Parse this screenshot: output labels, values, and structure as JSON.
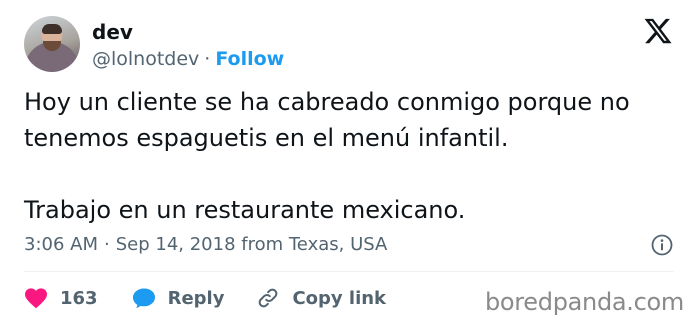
{
  "author": {
    "display_name": "dev",
    "handle": "@lolnotdev",
    "separator": "·",
    "follow_label": "Follow"
  },
  "tweet": {
    "lines_paragraph_1": [
      "Hoy un cliente se ha cabreado conmigo porque no",
      "tenemos espaguetis en el menú infantil."
    ],
    "paragraph_2": "Trabajo en un restaurante mexicano."
  },
  "meta": {
    "time": "3:06 AM",
    "separator": "·",
    "date_location": "Sep 14, 2018 from Texas, USA"
  },
  "actions": {
    "like_count": "163",
    "reply_label": "Reply",
    "copy_link_label": "Copy link"
  },
  "watermark": "boredpanda.com",
  "icons": {
    "logo": "x-logo-icon",
    "info": "info-icon",
    "like": "heart-icon",
    "reply": "speech-bubble-icon",
    "copy_link": "link-icon"
  },
  "colors": {
    "like": "#f91880",
    "reply": "#1d9bf0",
    "follow": "#1d9bf0",
    "secondary_text": "#536471"
  }
}
